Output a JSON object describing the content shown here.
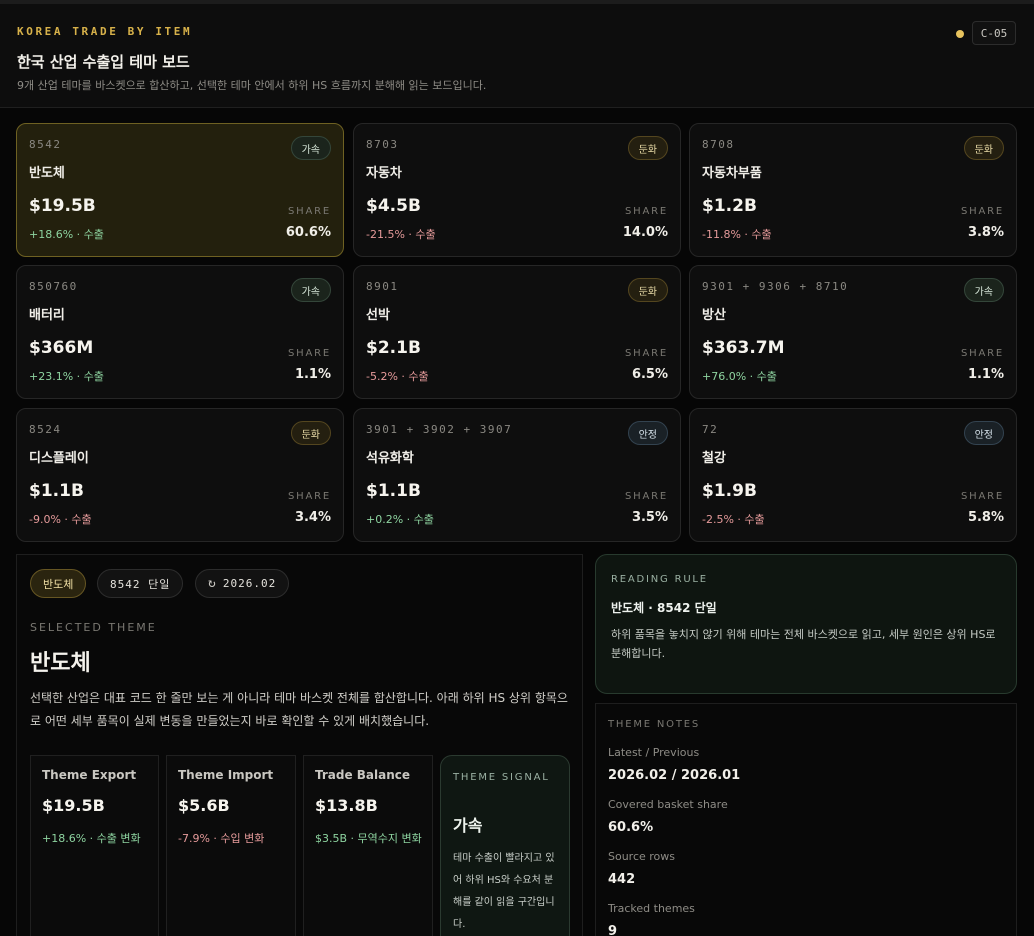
{
  "header": {
    "eyebrow": "KOREA TRADE BY ITEM",
    "title": "한국 산업 수출입 테마 보드",
    "subtitle": "9개 산업 테마를 바스켓으로 합산하고, 선택한 테마 안에서 하위 HS 흐름까지 분해해 읽는 보드입니다.",
    "badge": "C-05",
    "status_color": "#e7c35e"
  },
  "cards": [
    {
      "code": "8542",
      "name": "반도체",
      "tag": "가속",
      "value": "$19.5B",
      "change": "+18.6% · 수출",
      "share_label": "SHARE",
      "share": "60.6%"
    },
    {
      "code": "8703",
      "name": "자동차",
      "tag": "둔화",
      "value": "$4.5B",
      "change": "-21.5% · 수출",
      "share_label": "SHARE",
      "share": "14.0%"
    },
    {
      "code": "8708",
      "name": "자동차부품",
      "tag": "둔화",
      "value": "$1.2B",
      "change": "-11.8% · 수출",
      "share_label": "SHARE",
      "share": "3.8%"
    },
    {
      "code": "850760",
      "name": "배터리",
      "tag": "가속",
      "value": "$366M",
      "change": "+23.1% · 수출",
      "share_label": "SHARE",
      "share": "1.1%"
    },
    {
      "code": "8901",
      "name": "선박",
      "tag": "둔화",
      "value": "$2.1B",
      "change": "-5.2% · 수출",
      "share_label": "SHARE",
      "share": "6.5%"
    },
    {
      "code": "9301 + 9306 + 8710",
      "name": "방산",
      "tag": "가속",
      "value": "$363.7M",
      "change": "+76.0% · 수출",
      "share_label": "SHARE",
      "share": "1.1%"
    },
    {
      "code": "8524",
      "name": "디스플레이",
      "tag": "둔화",
      "value": "$1.1B",
      "change": "-9.0% · 수출",
      "share_label": "SHARE",
      "share": "3.4%"
    },
    {
      "code": "3901 + 3902 + 3907",
      "name": "석유화학",
      "tag": "안정",
      "value": "$1.1B",
      "change": "+0.2% · 수출",
      "share_label": "SHARE",
      "share": "3.5%"
    },
    {
      "code": "72",
      "name": "철강",
      "tag": "안정",
      "value": "$1.9B",
      "change": "-2.5% · 수출",
      "share_label": "SHARE",
      "share": "5.8%"
    }
  ],
  "detail": {
    "pill_theme": "반도체",
    "pill_code": "8542 단일",
    "pill_period": "2026.02",
    "selected_label": "SELECTED THEME",
    "selected_title": "반도체",
    "description": "선택한 산업은 대표 코드 한 줄만 보는 게 아니라 테마 바스켓 전체를 합산합니다. 아래 하위 HS 상위 항목으로 어떤 세부 품목이 실제 변동을 만들었는지 바로 확인할 수 있게 배치했습니다.",
    "metrics": [
      {
        "label": "Theme Export",
        "value": "$19.5B",
        "change": "+18.6% · 수출 변화"
      },
      {
        "label": "Theme Import",
        "value": "$5.6B",
        "change": "-7.9% · 수입 변화"
      },
      {
        "label": "Trade Balance",
        "value": "$13.8B",
        "change": "$3.5B · 무역수지 변화"
      }
    ],
    "signal": {
      "label": "THEME SIGNAL",
      "value": "가속",
      "description": "테마 수출이 빨라지고 있어 하위 HS와 수요처 분해를 같이 읽을 구간입니다."
    }
  },
  "reading_rule": {
    "label": "READING RULE",
    "title": "반도체 · 8542 단일",
    "description": "하위 품목을 놓치지 않기 위해 테마는 전체 바스켓으로 읽고, 세부 원인은 상위 HS로 분해합니다."
  },
  "notes": {
    "label": "THEME NOTES",
    "items": [
      {
        "key": "Latest / Previous",
        "value": "2026.02 / 2026.01"
      },
      {
        "key": "Covered basket share",
        "value": "60.6%"
      },
      {
        "key": "Source rows",
        "value": "442"
      },
      {
        "key": "Tracked themes",
        "value": "9"
      }
    ]
  },
  "colors": {
    "accent": "#d8b24a",
    "positive": "#8ed4a0",
    "negative": "#e59a9a"
  }
}
